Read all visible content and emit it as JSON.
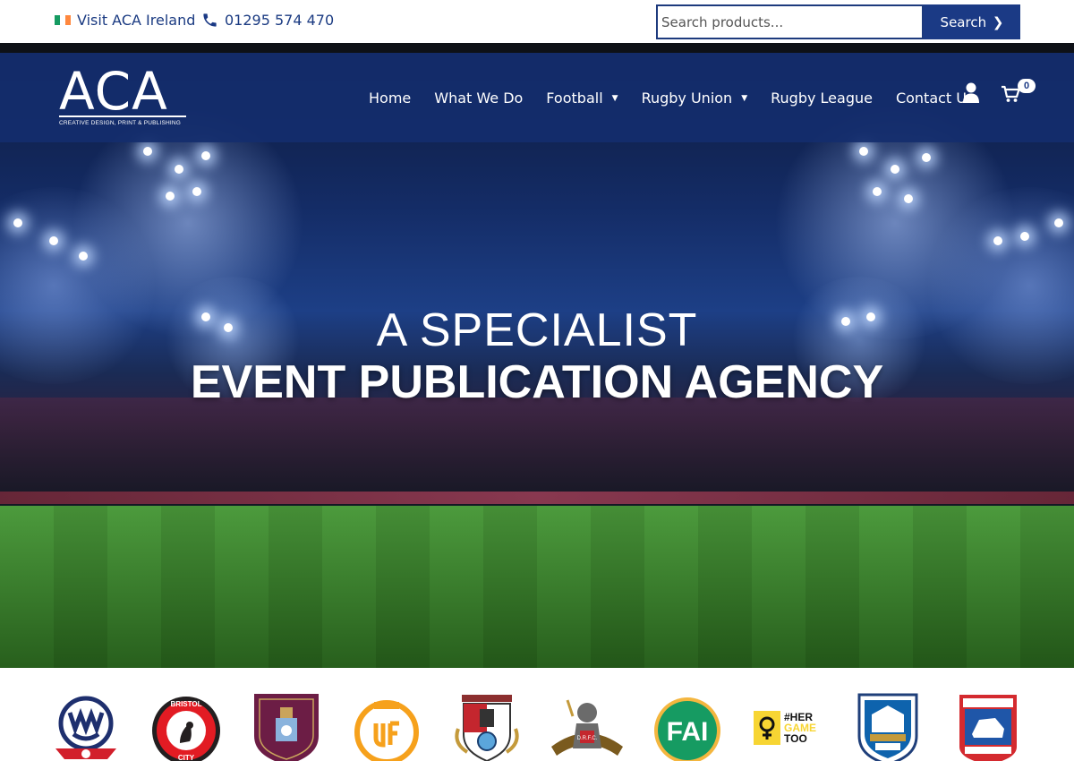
{
  "topbar": {
    "ireland_link": "Visit ACA Ireland",
    "phone": "01295 574 470",
    "search_placeholder": "Search products...",
    "search_button": "Search",
    "search_chevron": "❯"
  },
  "nav": {
    "logo_text": "ACA",
    "logo_tagline": "CREATIVE DESIGN, PRINT & PUBLISHING",
    "items": [
      {
        "label": "Home",
        "dropdown": false
      },
      {
        "label": "What We Do",
        "dropdown": false
      },
      {
        "label": "Football",
        "dropdown": true
      },
      {
        "label": "Rugby Union",
        "dropdown": true
      },
      {
        "label": "Rugby League",
        "dropdown": false
      },
      {
        "label": "Contact Us",
        "dropdown": false
      }
    ],
    "cart_count": "0"
  },
  "hero": {
    "line1": "A SPECIALIST",
    "line2": "EVENT PUBLICATION AGENCY"
  },
  "clubs": {
    "fai_text": "FAI",
    "hergametoo_text": [
      "#HER",
      "GAME",
      "TOO"
    ],
    "bristol_text": [
      "BRISTOL",
      "CITY"
    ]
  },
  "colors": {
    "brand_blue": "#1b3a85",
    "nav_blue": "#142d6e"
  }
}
